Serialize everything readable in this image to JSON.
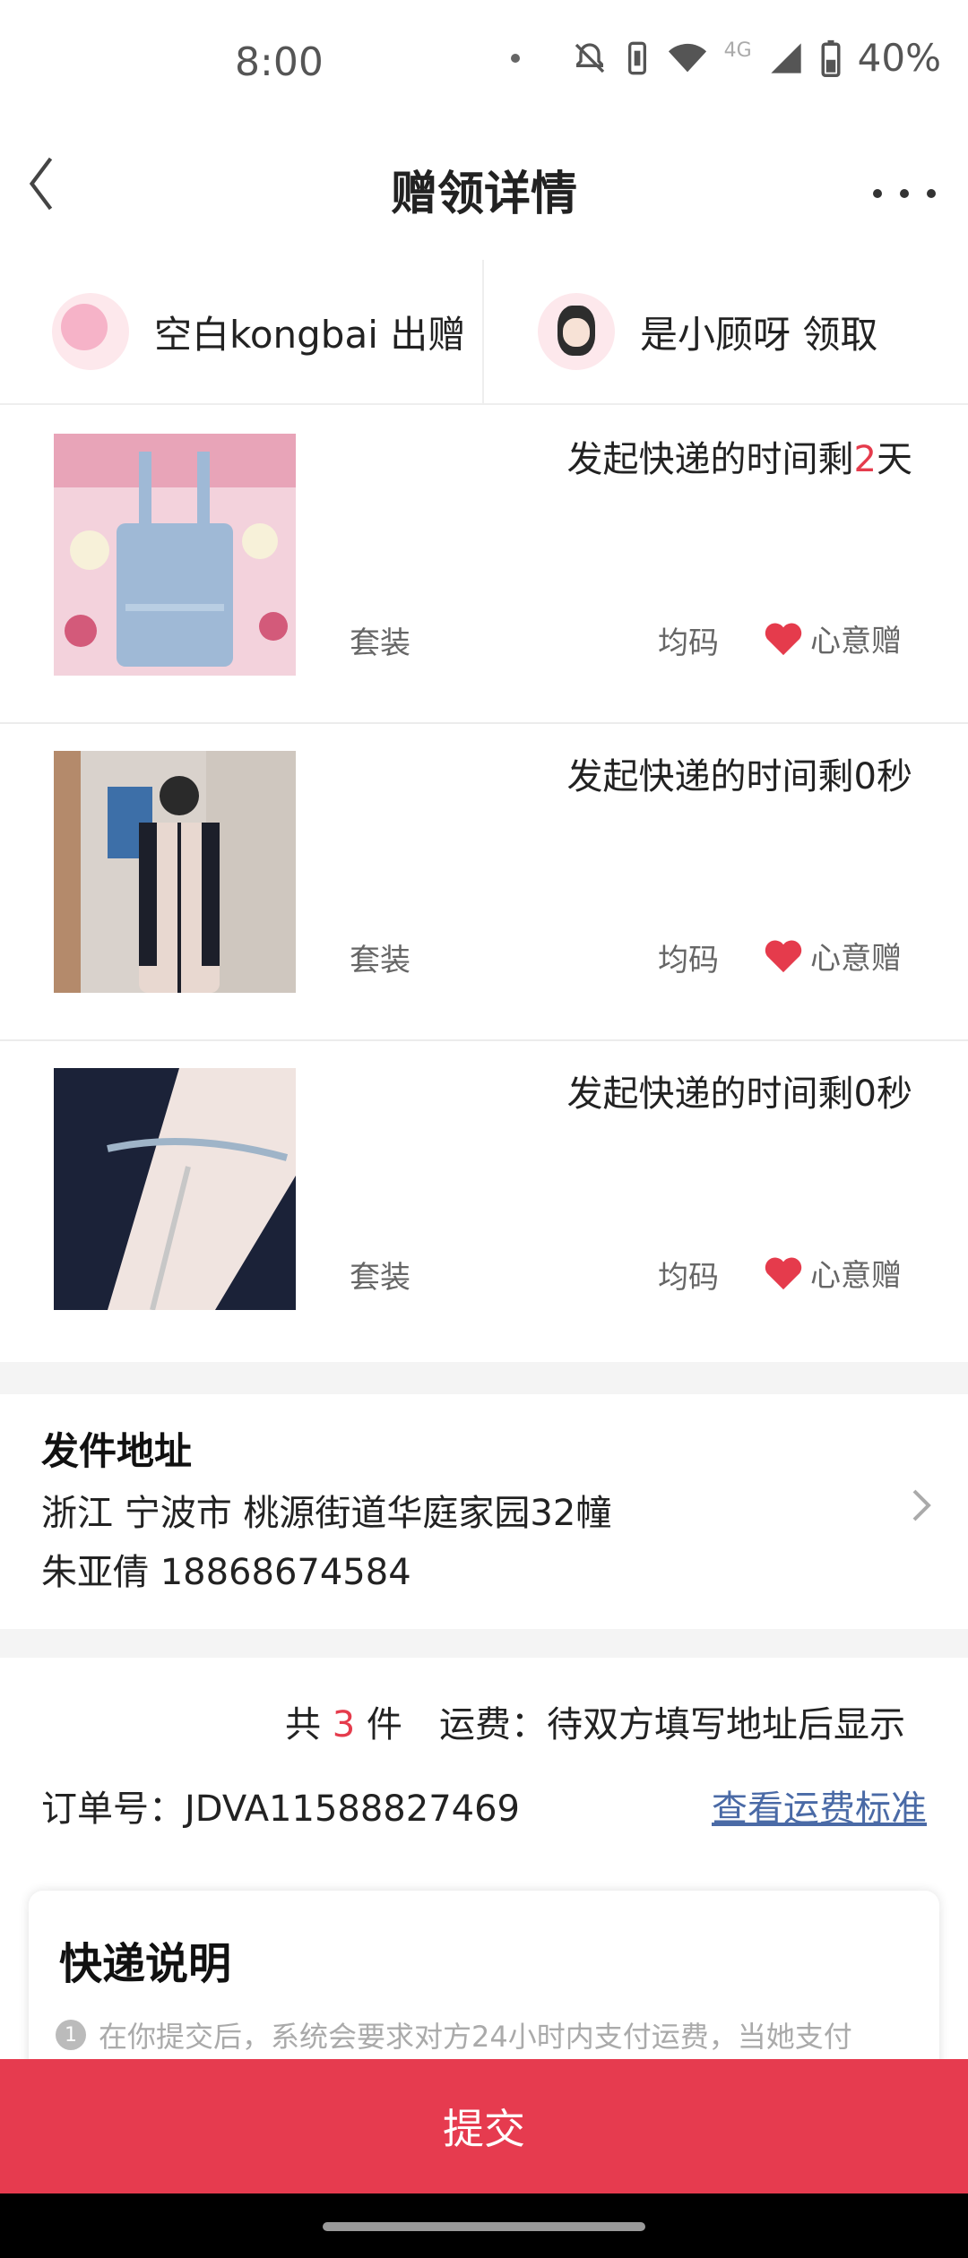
{
  "status_bar": {
    "time": "8:00",
    "network": "4G",
    "battery": "40%"
  },
  "header": {
    "title": "赠领详情"
  },
  "parties": {
    "giver": {
      "name": "空白kongbai",
      "action": "出赠"
    },
    "receiver": {
      "name": "是小顾呀",
      "action": "领取"
    }
  },
  "items": [
    {
      "countdown_prefix": "发起快递的时间剩",
      "countdown_value": "2",
      "countdown_suffix": "天",
      "category": "套装",
      "size": "均码",
      "tag": "心意赠"
    },
    {
      "countdown_prefix": "发起快递的时间剩",
      "countdown_value": "0",
      "countdown_suffix": "秒",
      "category": "套装",
      "size": "均码",
      "tag": "心意赠"
    },
    {
      "countdown_prefix": "发起快递的时间剩",
      "countdown_value": "0",
      "countdown_suffix": "秒",
      "category": "套装",
      "size": "均码",
      "tag": "心意赠"
    }
  ],
  "address": {
    "label": "发件地址",
    "line1": "浙江 宁波市 桃源街道华庭家园32幢",
    "line2": "朱亚倩 18868674584"
  },
  "summary": {
    "count_prefix": "共",
    "count": "3",
    "count_suffix": "件",
    "shipping": "运费：待双方填写地址后显示",
    "order": "订单号：JDVA11588827469",
    "fee_link": "查看运费标准"
  },
  "express": {
    "title": "快递说明",
    "badge": "1",
    "note": "在你提交后，系统会要求对方24小时内支付运费，当她支付"
  },
  "submit_label": "提交",
  "colors": {
    "accent": "#e63b4f",
    "link": "#4a6aa6"
  }
}
